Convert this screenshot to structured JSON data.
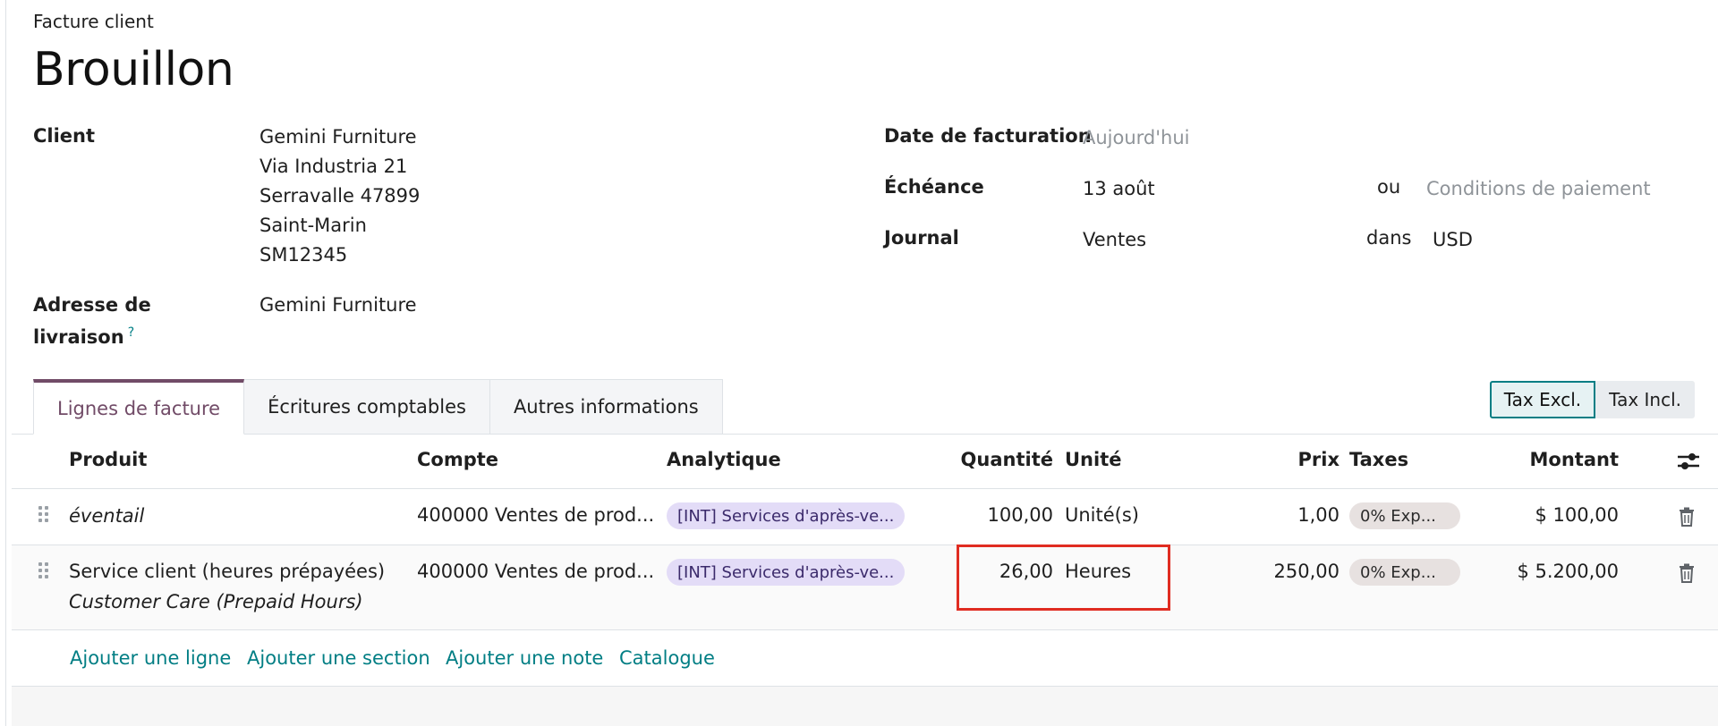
{
  "header": {
    "doc_type": "Facture client",
    "status_title": "Brouillon"
  },
  "customer": {
    "label": "Client",
    "name": "Gemini Furniture",
    "address": [
      "Via Industria 21",
      "Serravalle 47899",
      "Saint-Marin",
      "SM12345"
    ]
  },
  "delivery": {
    "label_line1": "Adresse de",
    "label_line2": "livraison",
    "help": "?",
    "value": "Gemini Furniture"
  },
  "invoice_date": {
    "label": "Date de facturation",
    "placeholder": "Aujourd'hui"
  },
  "due": {
    "label": "Échéance",
    "value": "13 août",
    "or": "ou",
    "terms_placeholder": "Conditions de paiement"
  },
  "journal": {
    "label": "Journal",
    "value": "Ventes",
    "in": "dans",
    "currency": "USD"
  },
  "tabs": [
    {
      "label": "Lignes de facture",
      "active": true
    },
    {
      "label": "Écritures comptables",
      "active": false
    },
    {
      "label": "Autres informations",
      "active": false
    }
  ],
  "tax_toggle": {
    "excl": "Tax Excl.",
    "incl": "Tax Incl."
  },
  "columns": {
    "product": "Produit",
    "account": "Compte",
    "analytic": "Analytique",
    "quantity": "Quantité",
    "unit": "Unité",
    "price": "Prix",
    "taxes": "Taxes",
    "amount": "Montant"
  },
  "lines": [
    {
      "product": "éventail",
      "account": "400000 Ventes de prod...",
      "analytic": "[INT] Services d'après-ve...",
      "quantity": "100,00",
      "unit": "Unité(s)",
      "price": "1,00",
      "tax": "0% Exp...",
      "amount": "$ 100,00"
    },
    {
      "product": "Service client (heures prépayées)",
      "description": "Customer Care (Prepaid Hours)",
      "account": "400000 Ventes de prod...",
      "analytic": "[INT] Services d'après-ve...",
      "quantity": "26,00",
      "unit": "Heures",
      "price": "250,00",
      "tax": "0% Exp...",
      "amount": "$ 5.200,00"
    }
  ],
  "actions": {
    "add_line": "Ajouter une ligne",
    "add_section": "Ajouter une section",
    "add_note": "Ajouter une note",
    "catalog": "Catalogue"
  },
  "colors": {
    "accent_teal": "#017e84",
    "tab_active": "#714b67",
    "highlight_red": "#e02c21",
    "analytic_badge": "#e3dcf7",
    "tax_badge": "#e7e1e0"
  }
}
